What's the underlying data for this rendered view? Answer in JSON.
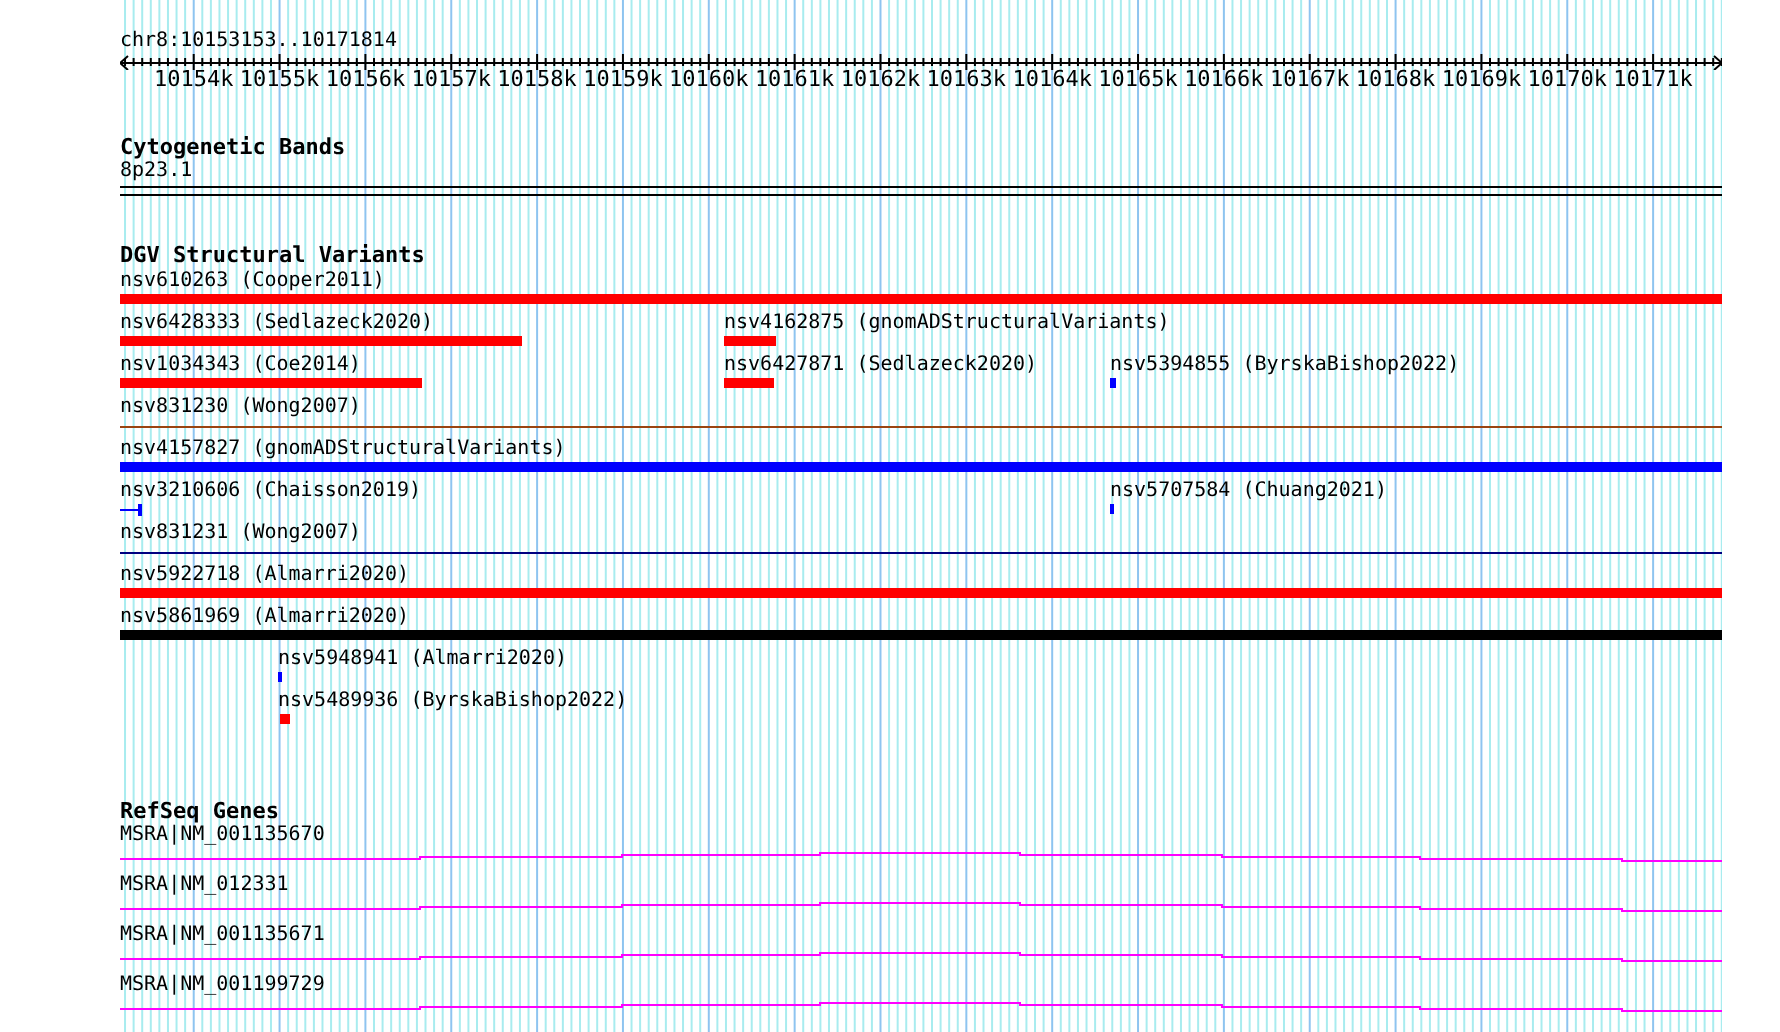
{
  "location": "chr8:10153153..10171814",
  "ruler": {
    "labels": [
      "10154k",
      "10155k",
      "10156k",
      "10157k",
      "10158k",
      "10159k",
      "10160k",
      "10161k",
      "10162k",
      "10163k",
      "10164k",
      "10165k",
      "10166k",
      "10167k",
      "10168k",
      "10169k",
      "10170k",
      "10171k"
    ]
  },
  "cytobands": {
    "title": "Cytogenetic Bands",
    "label": "8p23.1"
  },
  "variants": {
    "title": "DGV Structural Variants",
    "rows": [
      {
        "features": [
          {
            "label": "nsv610263 (Cooper2011)",
            "kind": "bar",
            "color": "#ff0000"
          }
        ]
      },
      {
        "features": [
          {
            "label": "nsv6428333 (Sedlazeck2020)",
            "kind": "bar",
            "color": "#ff0000"
          },
          {
            "label": "nsv4162875 (gnomADStructuralVariants)",
            "kind": "bar",
            "color": "#ff0000"
          }
        ]
      },
      {
        "features": [
          {
            "label": "nsv1034343 (Coe2014)",
            "kind": "bar",
            "color": "#ff0000"
          },
          {
            "label": "nsv6427871 (Sedlazeck2020)",
            "kind": "bar",
            "color": "#ff0000"
          },
          {
            "label": "nsv5394855 (ByrskaBishop2022)",
            "kind": "bar",
            "color": "#0000ff"
          }
        ]
      },
      {
        "features": [
          {
            "label": "nsv831230 (Wong2007)",
            "kind": "line",
            "color": "#994411"
          }
        ]
      },
      {
        "features": [
          {
            "label": "nsv4157827 (gnomADStructuralVariants)",
            "kind": "bar",
            "color": "#0000ff"
          }
        ]
      },
      {
        "features": [
          {
            "label": "nsv3210606 (Chaisson2019)",
            "kind": "bracket",
            "color": "#0000ff"
          },
          {
            "label": "nsv5707584 (Chuang2021)",
            "kind": "bar",
            "color": "#0000ff"
          }
        ]
      },
      {
        "features": [
          {
            "label": "nsv831231 (Wong2007)",
            "kind": "line",
            "color": "#000080"
          }
        ]
      },
      {
        "features": [
          {
            "label": "nsv5922718 (Almarri2020)",
            "kind": "bar",
            "color": "#ff0000"
          }
        ]
      },
      {
        "features": [
          {
            "label": "nsv5861969 (Almarri2020)",
            "kind": "bar",
            "color": "#000000"
          }
        ]
      },
      {
        "features": [
          {
            "label": "nsv5948941 (Almarri2020)",
            "kind": "bar",
            "color": "#0000ff"
          }
        ]
      },
      {
        "features": [
          {
            "label": "nsv5489936 (ByrskaBishop2022)",
            "kind": "bar",
            "color": "#ff0000"
          }
        ]
      }
    ]
  },
  "genes": {
    "title": "RefSeq Genes",
    "features": [
      {
        "label": "MSRA|NM_001135670"
      },
      {
        "label": "MSRA|NM_012331"
      },
      {
        "label": "MSRA|NM_001135671"
      },
      {
        "label": "MSRA|NM_001199729"
      }
    ]
  }
}
